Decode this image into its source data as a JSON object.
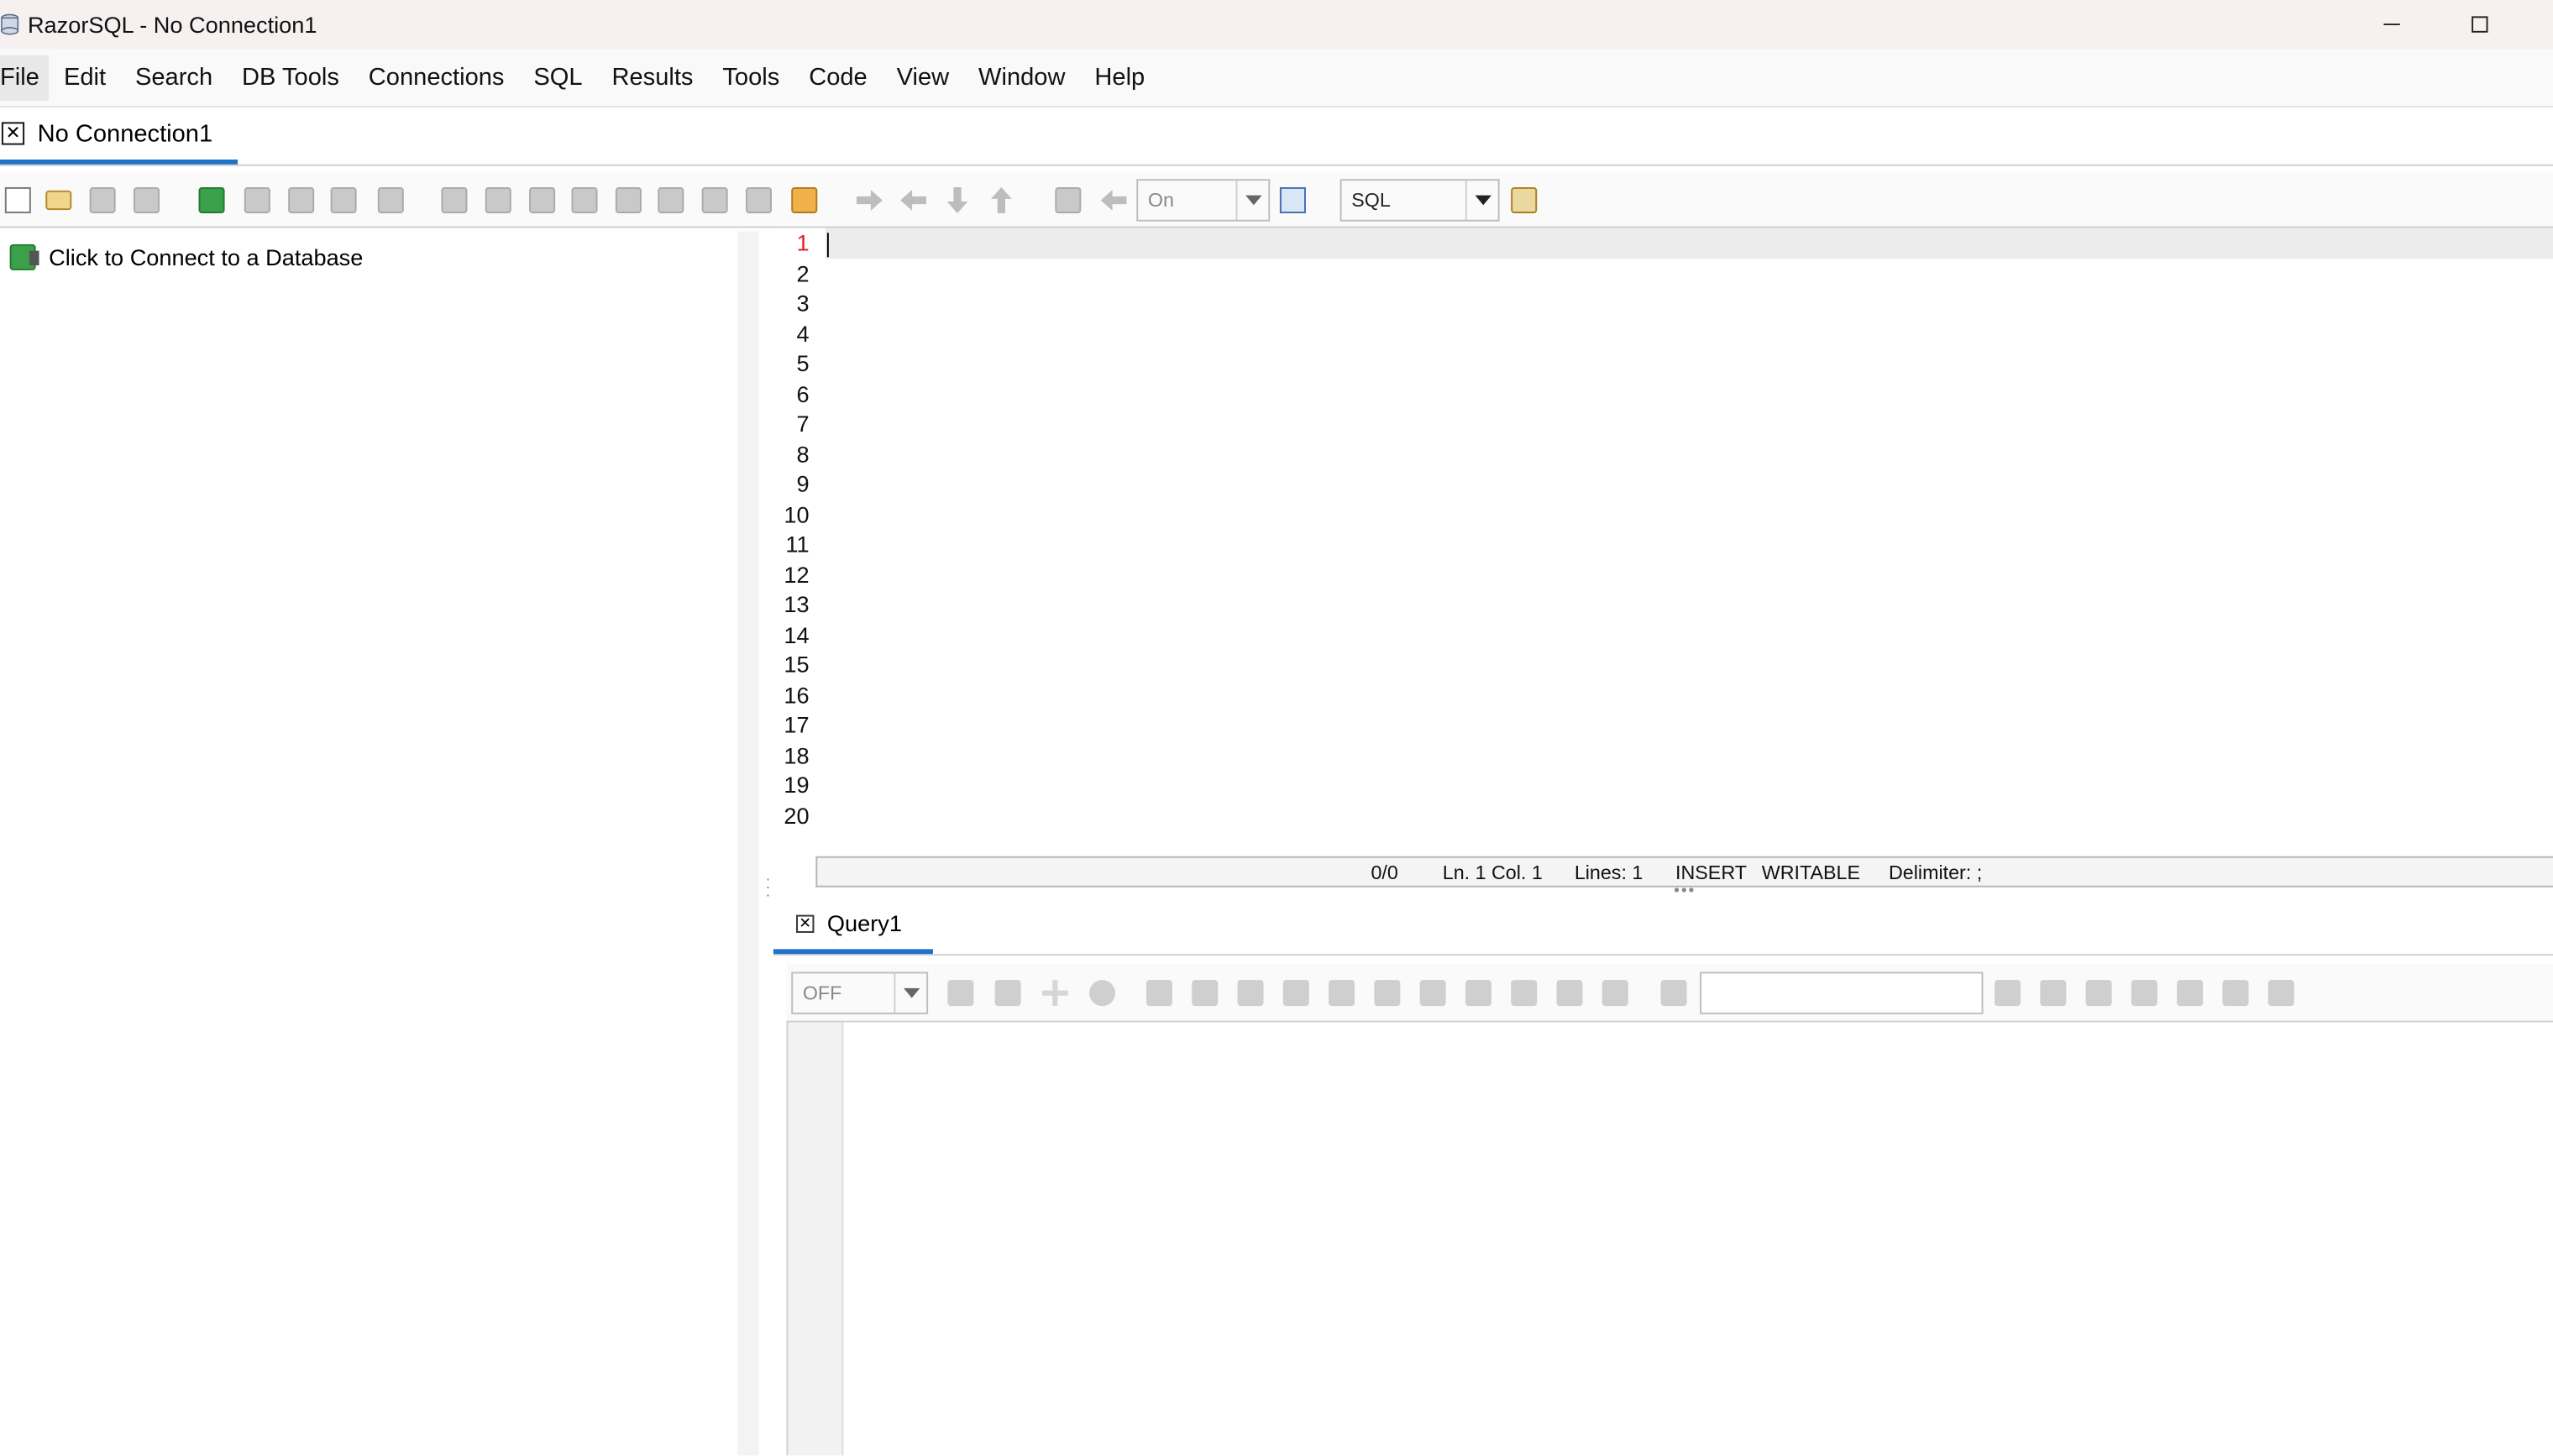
{
  "window": {
    "title": "RazorSQL - No Connection1",
    "minimize": "—",
    "maximize": "☐"
  },
  "menu": {
    "items": [
      "File",
      "Edit",
      "Search",
      "DB Tools",
      "Connections",
      "SQL",
      "Results",
      "Tools",
      "Code",
      "View",
      "Window",
      "Help"
    ]
  },
  "connection_tab": {
    "label": "No Connection1",
    "close": "✕"
  },
  "toolbar": {
    "auto_commit_value": "On",
    "language_value": "SQL"
  },
  "navigator": {
    "connect_label": "Click to Connect to a Database"
  },
  "editor": {
    "line_numbers": [
      "1",
      "2",
      "3",
      "4",
      "5",
      "6",
      "7",
      "8",
      "9",
      "10",
      "11",
      "12",
      "13",
      "14",
      "15",
      "16",
      "17",
      "18",
      "19",
      "20"
    ],
    "active_line": "1"
  },
  "editor_status": {
    "position": "0/0",
    "line_col": "Ln. 1 Col. 1",
    "lines": "Lines: 1",
    "mode": "INSERT",
    "writable": "WRITABLE",
    "delimiter": "Delimiter: ;"
  },
  "query_tab": {
    "label": "Query1",
    "close": "✕"
  },
  "results_toolbar": {
    "filter_value": "OFF",
    "search_value": ""
  },
  "colors": {
    "accent": "#1e73c8",
    "active_line_number": "#e01e1e",
    "title_bar": "#f7f0f0"
  }
}
